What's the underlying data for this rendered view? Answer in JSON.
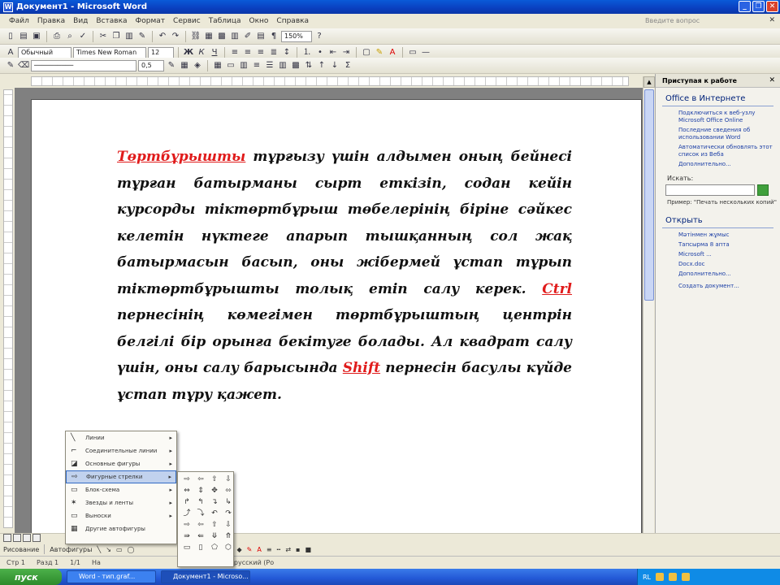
{
  "window": {
    "title": "Документ1 - Microsoft Word"
  },
  "menu": {
    "items": [
      "Файл",
      "Правка",
      "Вид",
      "Вставка",
      "Формат",
      "Сервис",
      "Таблица",
      "Окно",
      "Справка"
    ],
    "help_placeholder": "Введите вопрос"
  },
  "toolbar": {
    "zoom": "150%",
    "style": "Обычный",
    "font": "Times New Roman",
    "size": "12",
    "line_width": "0,5"
  },
  "document": {
    "p1_hl": "Төртбұрышты",
    "p1_rest": " тұрғызу үшін алдымен оның бейнесі тұрған батырманы сырт еткізіп, содан кейін курсорды тіктөртбұрыш төбелерінің біріне сәйкес келетін нүктеге апарып тышқанның сол жақ батырмасын басып, оны жібермей ұстап тұрып тіктөртбұрышты толық етіп салу керек. ",
    "ctrl": "Ctrl",
    "p2": " пернесінің көмегімен төртбұрыштың центрін белгілі бір орынға бекітуге болады. Ал квадрат салу үшін, оны салу барысында ",
    "shift": "Shift",
    "p3": " пернесін басулы күйде ұстап тұру қажет."
  },
  "taskpane": {
    "header": "Приступая к работе",
    "office_section": "Office в Интернете",
    "links": [
      "Подключиться к веб-узлу Microsoft Office Online",
      "Последние сведения об использовании Word",
      "Автоматически обновлять этот список из Веба",
      "Дополнительно..."
    ],
    "search_label": "Искать:",
    "example": "Пример: \"Печать нескольких копий\"",
    "open_section": "Открыть",
    "files": [
      "Мәтінмен жұмыс",
      "Тапсырма 8 апта",
      "Microsoft ...",
      "Docx.doc",
      "Дополнительно...",
      "Создать документ..."
    ]
  },
  "autoshapes_menu": {
    "items": [
      "Линии",
      "Соединительные линии",
      "Основные фигуры",
      "Фигурные стрелки",
      "Блок-схема",
      "Звезды и ленты",
      "Выноски",
      "Другие автофигуры"
    ],
    "selected_index": 3,
    "sub_glyphs": [
      "⇨",
      "⇦",
      "⇧",
      "⇩",
      "⇔",
      "⇕",
      "✥",
      "⬄",
      "↱",
      "↰",
      "↴",
      "↳",
      "⤴",
      "⤵",
      "↶",
      "↷",
      "⇨",
      "⇦",
      "⇧",
      "⇩",
      "⇛",
      "⇚",
      "⤋",
      "⤊",
      "▭",
      "▯",
      "⬠",
      "⬡"
    ]
  },
  "drawing": {
    "draw_label": "Рисование",
    "autoshapes_label": "Автофигуры"
  },
  "status": {
    "page": "Стр 1",
    "section": "Разд 1",
    "pages": "1/1",
    "at": "На",
    "lang": "русский (Ро"
  },
  "taskbar": {
    "start": "пуск",
    "tasks": [
      "Word - тип.graf...",
      "Документ1 - Microso..."
    ],
    "tray_lang": "RL"
  }
}
